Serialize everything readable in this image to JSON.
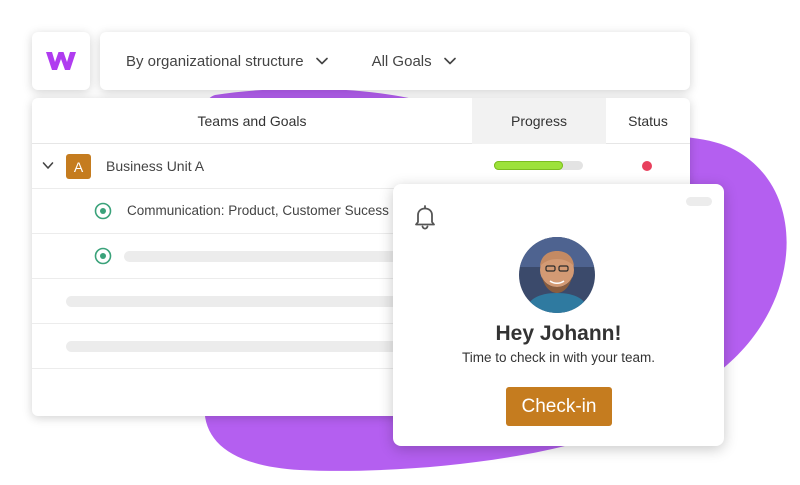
{
  "logo": {
    "letter": "W",
    "icon": "brand-logo-icon",
    "color": "#b03cf0"
  },
  "filters": {
    "structure_label": "By organizational structure",
    "goals_label": "All Goals",
    "icon": "chevron-down-icon"
  },
  "table": {
    "headers": {
      "teams": "Teams and Goals",
      "progress": "Progress",
      "status": "Status"
    },
    "rows": [
      {
        "type": "unit",
        "badge": "A",
        "label": "Business Unit A",
        "progress": 0.78,
        "status_color": "#e8405d",
        "expand_icon": "chevron-down-icon"
      },
      {
        "type": "goal",
        "label": "Communication: Product, Customer Sucess and",
        "icon": "target-icon"
      },
      {
        "type": "goal",
        "label": "",
        "icon": "target-icon"
      }
    ]
  },
  "notification": {
    "icon": "bell-icon",
    "greeting": "Hey Johann!",
    "message": "Time to check in with your team.",
    "button_label": "Check-in",
    "accent": "#c57c1f"
  },
  "colors": {
    "blob": "#b45ff0",
    "progress": "#9de23a",
    "status": "#e8405d",
    "badge": "#c57c1f"
  }
}
